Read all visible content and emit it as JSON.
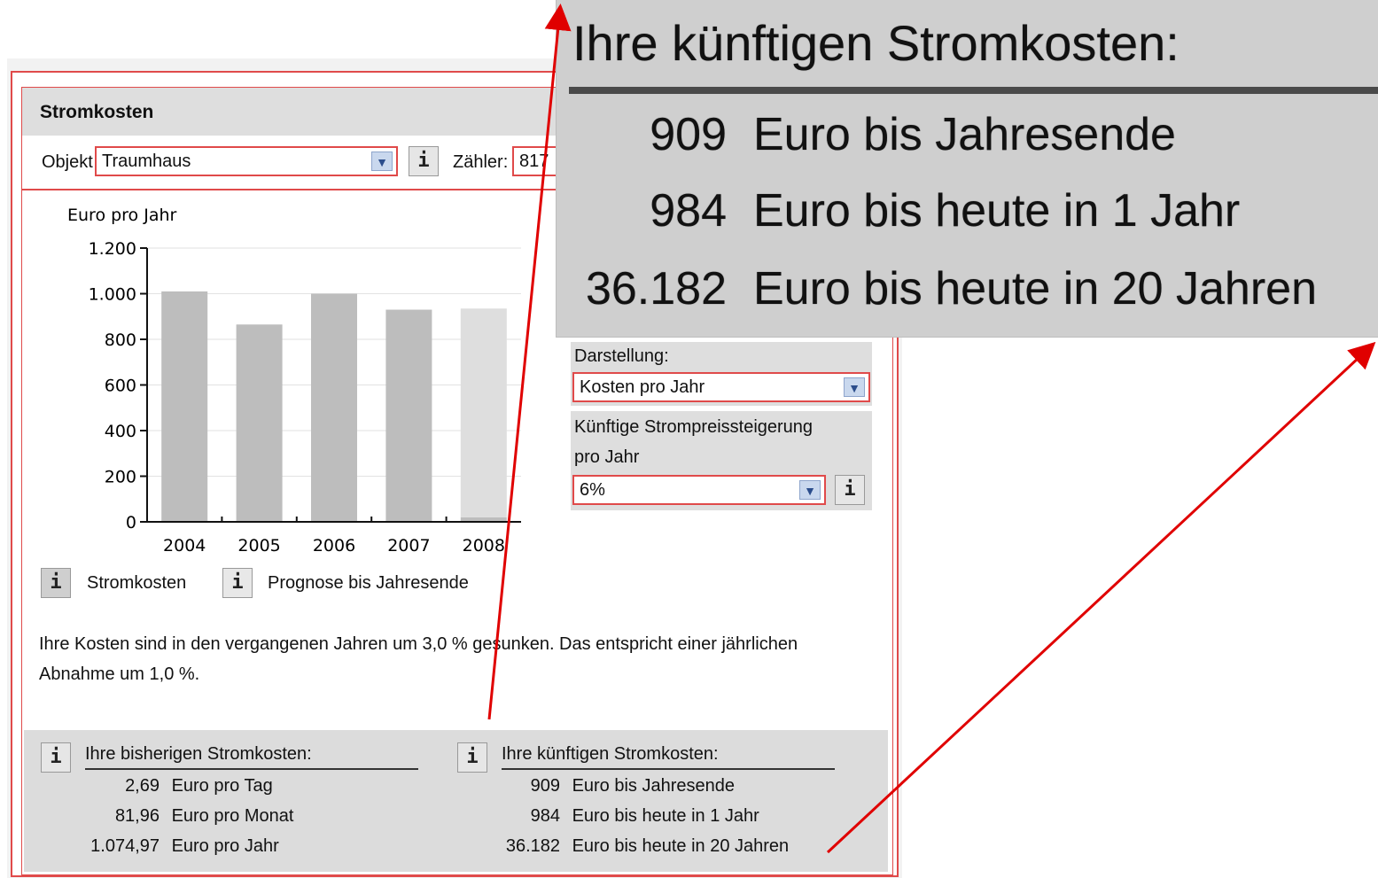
{
  "window": {
    "title": "Stromkosten"
  },
  "selectors": {
    "objekt_label": "Objekt",
    "objekt_value": "Traumhaus",
    "zaehler_label": "Zähler:",
    "zaehler_value": "817"
  },
  "info_glyph": "i",
  "chart_data": {
    "type": "bar",
    "ylabel": "Euro pro Jahr",
    "categories": [
      "2004",
      "2005",
      "2006",
      "2007",
      "2008"
    ],
    "series": [
      {
        "name": "Stromkosten",
        "values": [
          1010,
          865,
          1000,
          930,
          20
        ]
      },
      {
        "name": "Prognose bis Jahresende",
        "values": [
          0,
          0,
          0,
          0,
          915
        ]
      }
    ],
    "y_ticks": [
      "0",
      "200",
      "400",
      "600",
      "800",
      "1.000",
      "1.200"
    ],
    "ylim": [
      0,
      1200
    ],
    "colors": {
      "Stromkosten": "#bdbdbd",
      "Prognose bis Jahresende": "#dedede"
    }
  },
  "legend": {
    "item1": "Stromkosten",
    "item2": "Prognose bis Jahresende"
  },
  "controls": {
    "darstellung_label": "Darstellung:",
    "darstellung_value": "Kosten pro Jahr",
    "steigerung_label_1": "Künftige Strompreissteigerung",
    "steigerung_label_2": "pro Jahr",
    "steigerung_value": "6%"
  },
  "summary": {
    "line1": "Ihre Kosten sind in den vergangenen Jahren um 3,0 % gesunken. Das entspricht einer jährlichen",
    "line2": "Abnahme um 1,0 %."
  },
  "bisherige": {
    "title": "Ihre bisherigen Stromkosten:",
    "rows": [
      {
        "value": "2,69",
        "unit": "Euro pro Tag"
      },
      {
        "value": "81,96",
        "unit": "Euro pro Monat"
      },
      {
        "value": "1.074,97",
        "unit": "Euro pro Jahr"
      }
    ]
  },
  "kuenftige": {
    "title": "Ihre künftigen Stromkosten:",
    "rows": [
      {
        "value": "909",
        "unit": "Euro bis Jahresende"
      },
      {
        "value": "984",
        "unit": "Euro bis heute in 1 Jahr"
      },
      {
        "value": "36.182",
        "unit": "Euro bis heute in 20 Jahren"
      }
    ]
  },
  "zoom": {
    "title": "Ihre künftigen Stromkosten:",
    "rows": [
      {
        "value": "909",
        "unit": "Euro bis Jahresende"
      },
      {
        "value": "984",
        "unit": "Euro bis heute in 1 Jahr"
      },
      {
        "value": "36.182",
        "unit": "Euro bis heute in 20 Jahren"
      }
    ]
  },
  "colors": {
    "accent_red": "#e00000",
    "frame_red": "#e04a4a",
    "panel_gray": "#dedede"
  }
}
